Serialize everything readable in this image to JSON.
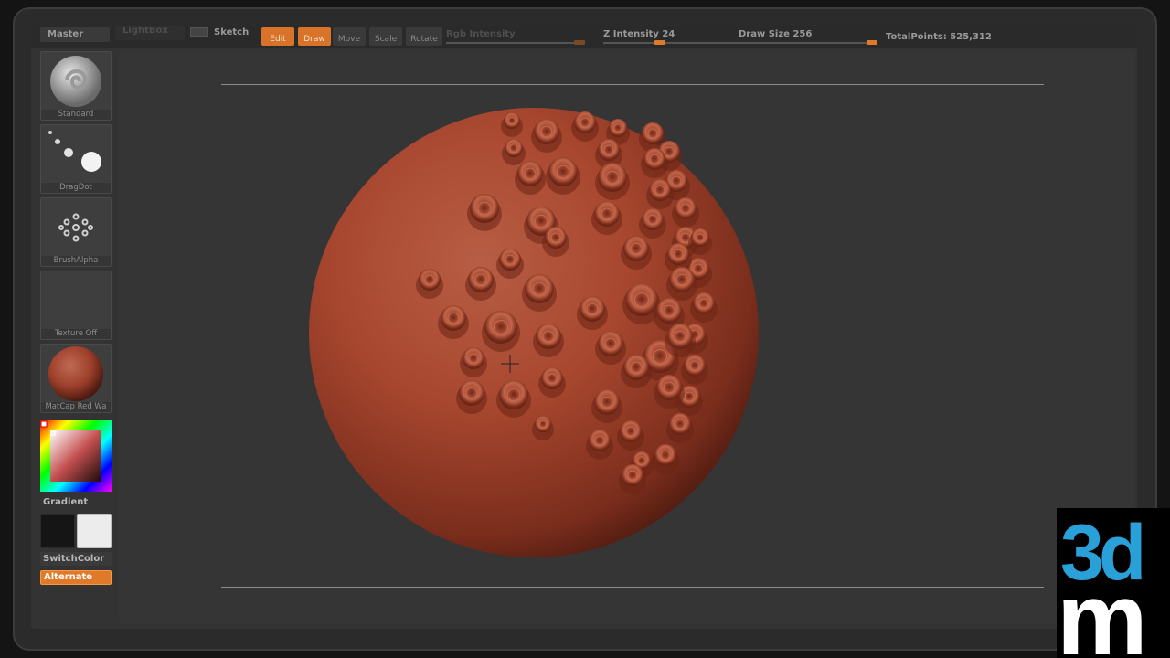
{
  "topbar": {
    "menu": "Master",
    "lightbox": "LightBox",
    "sketch": "Sketch",
    "edit": "Edit",
    "draw": "Draw",
    "move": "Move",
    "scale": "Scale",
    "rotate": "Rotate",
    "rgb_intensity": "Rgb Intensity",
    "z_intensity": "Z Intensity 24",
    "draw_size": "Draw Size 256",
    "total_points": "TotalPoints: 525,312"
  },
  "shelf": {
    "brush": "Standard",
    "stroke": "DragDot",
    "alpha": "BrushAlpha",
    "texture": "Texture Off",
    "material": "MatCap Red Wa",
    "gradient": "Gradient",
    "switch_color": "SwitchColor",
    "alternate": "Alternate"
  },
  "colors": {
    "accent": "#e07a2a",
    "sculpt": "#a8472f",
    "logo_blue": "#2aa0d8"
  },
  "logo": {
    "top": "3d",
    "bottom": "m"
  }
}
